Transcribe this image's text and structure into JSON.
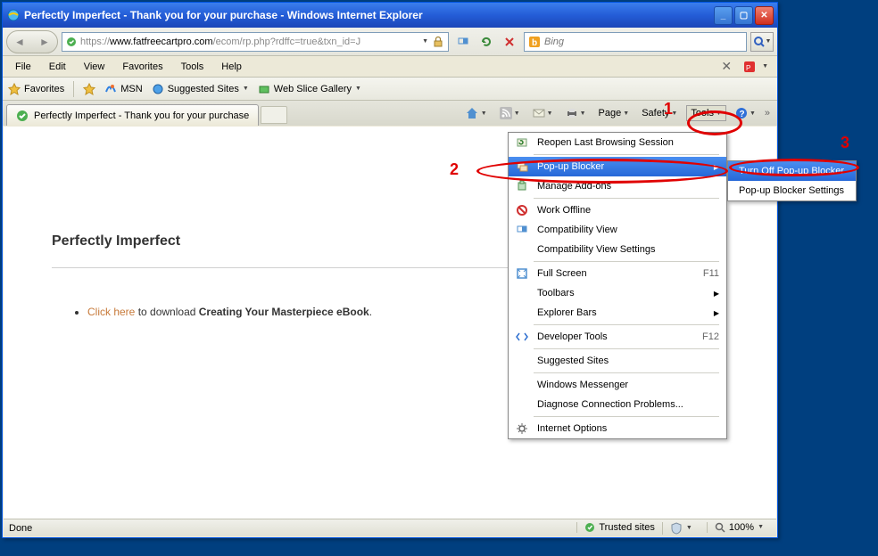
{
  "titlebar": {
    "title": "Perfectly Imperfect - Thank you for your purchase - Windows Internet Explorer"
  },
  "navbar": {
    "url_prefix": "https://",
    "url_host": "www.fatfreecartpro.com",
    "url_path": "/ecom/rp.php?rdffc=true&txn_id=J"
  },
  "search": {
    "placeholder": "Bing"
  },
  "menubar": {
    "items": [
      "File",
      "Edit",
      "View",
      "Favorites",
      "Tools",
      "Help"
    ]
  },
  "favbar": {
    "label": "Favorites",
    "items": [
      "MSN",
      "Suggested Sites",
      "Web Slice Gallery"
    ]
  },
  "tab": {
    "title": "Perfectly Imperfect - Thank you for your purchase"
  },
  "cmdbar": {
    "page": "Page",
    "safety": "Safety",
    "tools": "Tools"
  },
  "page": {
    "heading": "Perfectly Imperfect",
    "link_text": "Click here",
    "mid_text": " to download ",
    "bold_text": "Creating Your Masterpiece eBook",
    "period": "."
  },
  "statusbar": {
    "done": "Done",
    "trusted": "Trusted sites",
    "zoom": "100%"
  },
  "tools_menu": {
    "reopen": "Reopen Last Browsing Session",
    "popup": "Pop-up Blocker",
    "addons": "Manage Add-ons",
    "offline": "Work Offline",
    "compat": "Compatibility View",
    "compat_settings": "Compatibility View Settings",
    "fullscreen": "Full Screen",
    "fullscreen_key": "F11",
    "toolbars": "Toolbars",
    "explorer_bars": "Explorer Bars",
    "devtools": "Developer Tools",
    "devtools_key": "F12",
    "suggested": "Suggested Sites",
    "messenger": "Windows Messenger",
    "diagnose": "Diagnose Connection Problems...",
    "internet_options": "Internet Options"
  },
  "popup_submenu": {
    "turn_off": "Turn Off Pop-up Blocker",
    "settings": "Pop-up Blocker Settings"
  },
  "annotations": {
    "n1": "1",
    "n2": "2",
    "n3": "3"
  }
}
